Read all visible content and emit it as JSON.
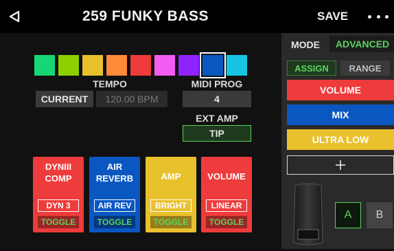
{
  "header": {
    "title": "259 FUNKY BASS",
    "save_label": "SAVE"
  },
  "colors": {
    "swatches": [
      "#16d776",
      "#8cd000",
      "#e9c12d",
      "#ff8a3a",
      "#ee3b3b",
      "#f25cf0",
      "#8f23ff",
      "#0a57c2",
      "#17c5e3"
    ],
    "selected_index": 7,
    "accent_green": "#5bd35b"
  },
  "tempo": {
    "label": "TEMPO",
    "source": "CURRENT",
    "bpm": "120.00 BPM"
  },
  "midi_prog": {
    "label": "MIDI PROG",
    "value": "4"
  },
  "ext_amp": {
    "label": "EXT AMP",
    "value": "TIP"
  },
  "footswitches": [
    {
      "name": "DYNIII\nCOMP",
      "param": "DYN 3",
      "toggle": "TOGGLE",
      "color": "#ee3b3b"
    },
    {
      "name": "AIR\nREVERB",
      "param": "AIR REV",
      "toggle": "TOGGLE",
      "color": "#0a57c2"
    },
    {
      "name": "AMP",
      "param": "BRIGHT",
      "toggle": "TOGGLE",
      "color": "#e9c12d"
    },
    {
      "name": "VOLUME",
      "param": "LINEAR",
      "toggle": "TOGGLE",
      "color": "#ee3b3b"
    }
  ],
  "side": {
    "mode_label": "MODE",
    "mode_value": "ADVANCED",
    "assign_label": "ASSIGN",
    "range_label": "RANGE",
    "assignments": [
      {
        "label": "VOLUME",
        "color": "#ee3b3b"
      },
      {
        "label": "MIX",
        "color": "#0a57c2"
      },
      {
        "label": "ULTRA LOW",
        "color": "#e9c12d"
      }
    ],
    "add_icon": "plus-icon",
    "expr_a": "A",
    "expr_b": "B"
  }
}
